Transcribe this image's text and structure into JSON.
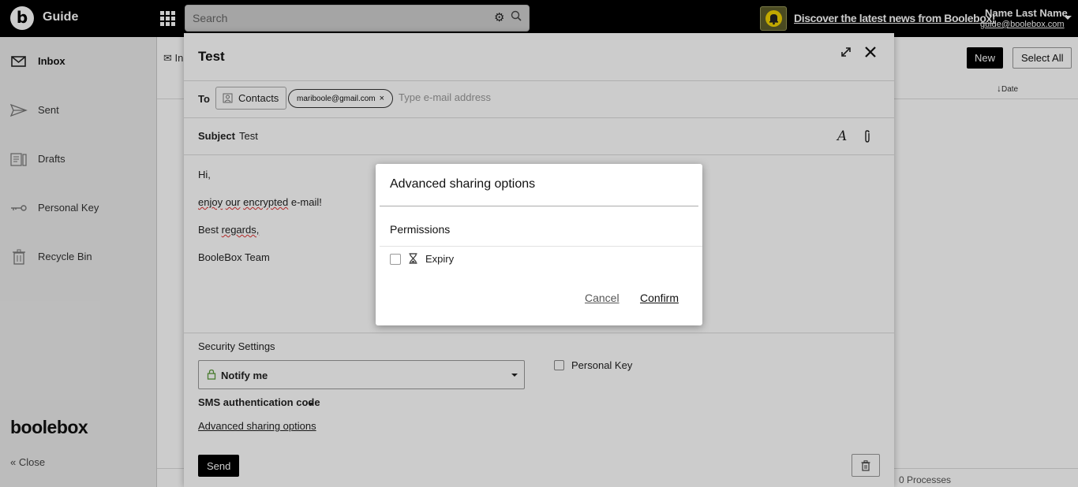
{
  "topbar": {
    "logo_letter": "b",
    "app_name": "Guide",
    "search_placeholder": "Search",
    "news_link": "Discover the latest news from Boolebox!",
    "user_name": "Name Last Name",
    "user_email": "guide@boolebox.com"
  },
  "sidebar": {
    "items": [
      {
        "label": "Inbox",
        "icon": "envelope-icon"
      },
      {
        "label": "Sent",
        "icon": "paper-plane-icon"
      },
      {
        "label": "Drafts",
        "icon": "drafts-icon"
      },
      {
        "label": "Personal Key",
        "icon": "key-icon"
      },
      {
        "label": "Recycle Bin",
        "icon": "trash-icon"
      }
    ],
    "brand": "boolebox",
    "close_label": "Close"
  },
  "main": {
    "tab_label": "In",
    "new_button": "New",
    "select_all_button": "Select All",
    "sort_label": "Date",
    "processes": "0 Processes"
  },
  "compose": {
    "title": "Test",
    "to_label": "To",
    "contacts_button": "Contacts",
    "recipient": "mariboole@gmail.com",
    "to_placeholder": "Type e-mail address",
    "subject_label": "Subject",
    "subject_value": "Test",
    "body": {
      "greeting": "Hi,",
      "line2_words": [
        "enjoy",
        "our",
        "encrypted",
        "e-mail!"
      ],
      "closing_word1": "Best",
      "closing_word2": "regards,",
      "signature": "BooleBox Team"
    },
    "security_label": "Security Settings",
    "notify_value": "Notify me",
    "personal_key_label": "Personal Key",
    "sms_label": "SMS authentication code",
    "advanced_link": "Advanced sharing options",
    "send_button": "Send"
  },
  "modal": {
    "title": "Advanced sharing options",
    "section": "Permissions",
    "expiry_label": "Expiry",
    "expiry_checked": false,
    "cancel": "Cancel",
    "confirm": "Confirm"
  },
  "colors": {
    "topbar": "#000000",
    "bell": "#f2d300",
    "lock": "#5a9a3a"
  }
}
